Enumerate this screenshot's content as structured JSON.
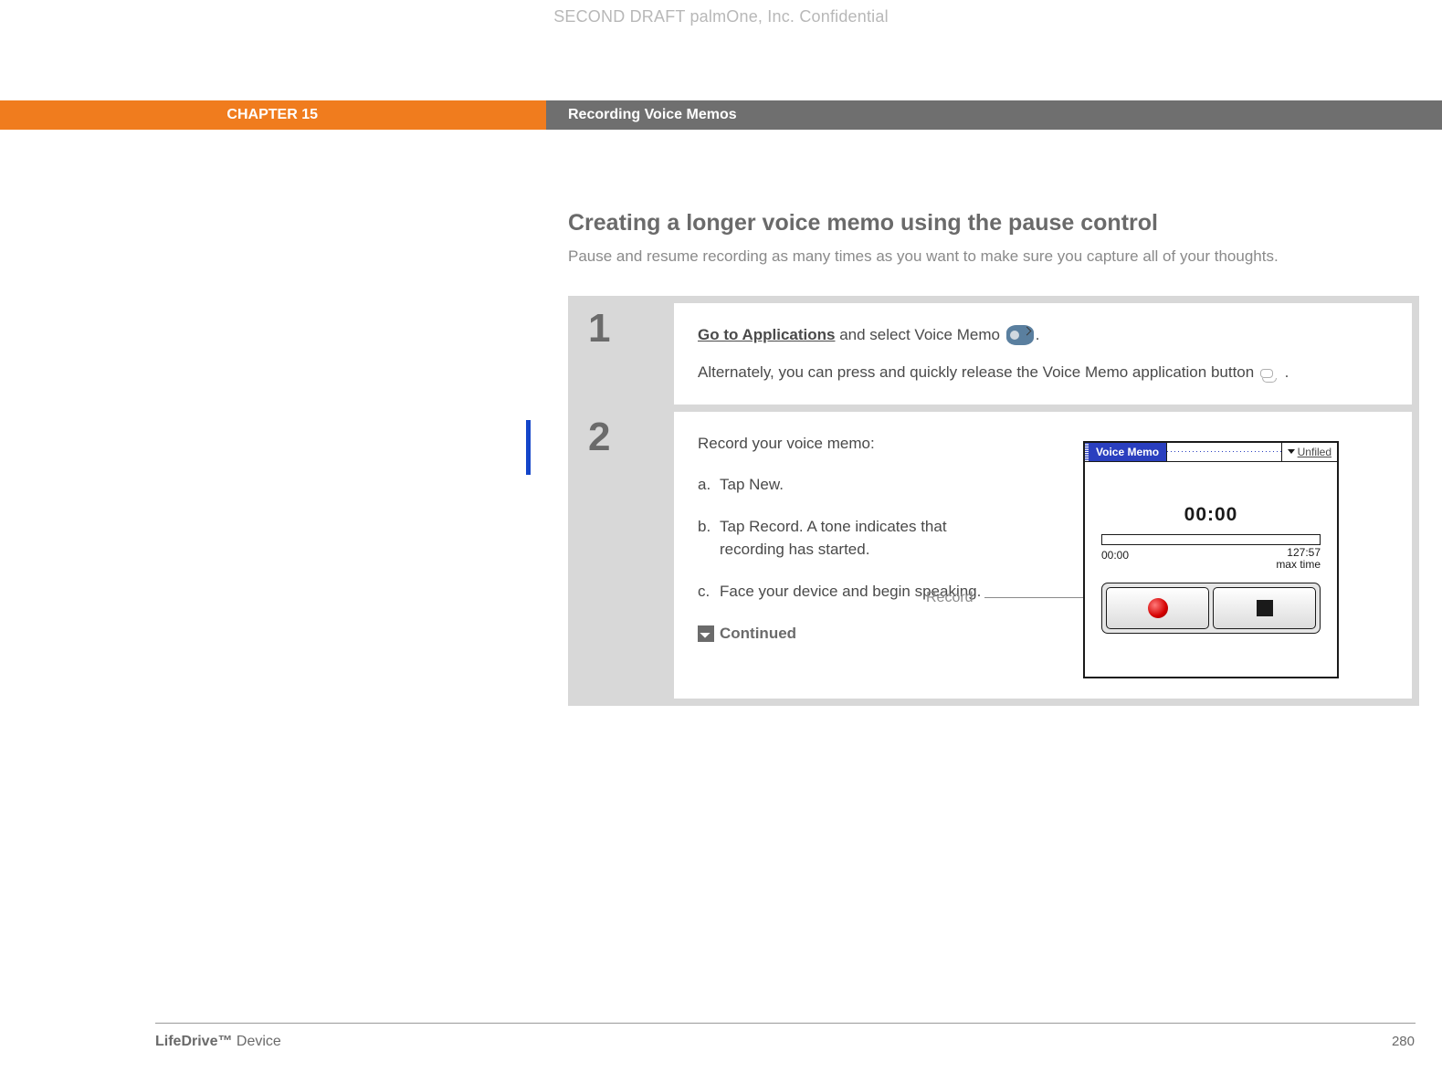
{
  "header": {
    "watermark": "SECOND DRAFT palmOne, Inc.  Confidential",
    "chapter_label": "CHAPTER 15",
    "chapter_title": "Recording Voice Memos"
  },
  "section": {
    "title": "Creating a longer voice memo using the pause control",
    "description": "Pause and resume recording as many times as you want to make sure you capture all of your thoughts."
  },
  "steps": {
    "one": {
      "number": "1",
      "link_text": "Go to Applications",
      "line1_rest": " and select Voice Memo ",
      "line1_end": ".",
      "line2_a": "Alternately, you can press and quickly release the Voice Memo application button ",
      "line2_end": " ."
    },
    "two": {
      "number": "2",
      "lead": "Record your voice memo:",
      "sub": {
        "a": {
          "label": "a.",
          "text": "Tap New."
        },
        "b": {
          "label": "b.",
          "text": "Tap Record. A tone indicates that recording has started."
        },
        "c": {
          "label": "c.",
          "text": "Face your device and begin speaking."
        }
      },
      "continued": "Continued"
    }
  },
  "callout": {
    "record_label": "Record"
  },
  "device_screen": {
    "title": "Voice Memo",
    "category": "Unfiled",
    "timer": "00:00",
    "elapsed": "00:00",
    "max_time_value": "127:57",
    "max_time_label": "max time"
  },
  "footer": {
    "product_bold": "LifeDrive™",
    "product_rest": "Device",
    "page_number": "280"
  }
}
